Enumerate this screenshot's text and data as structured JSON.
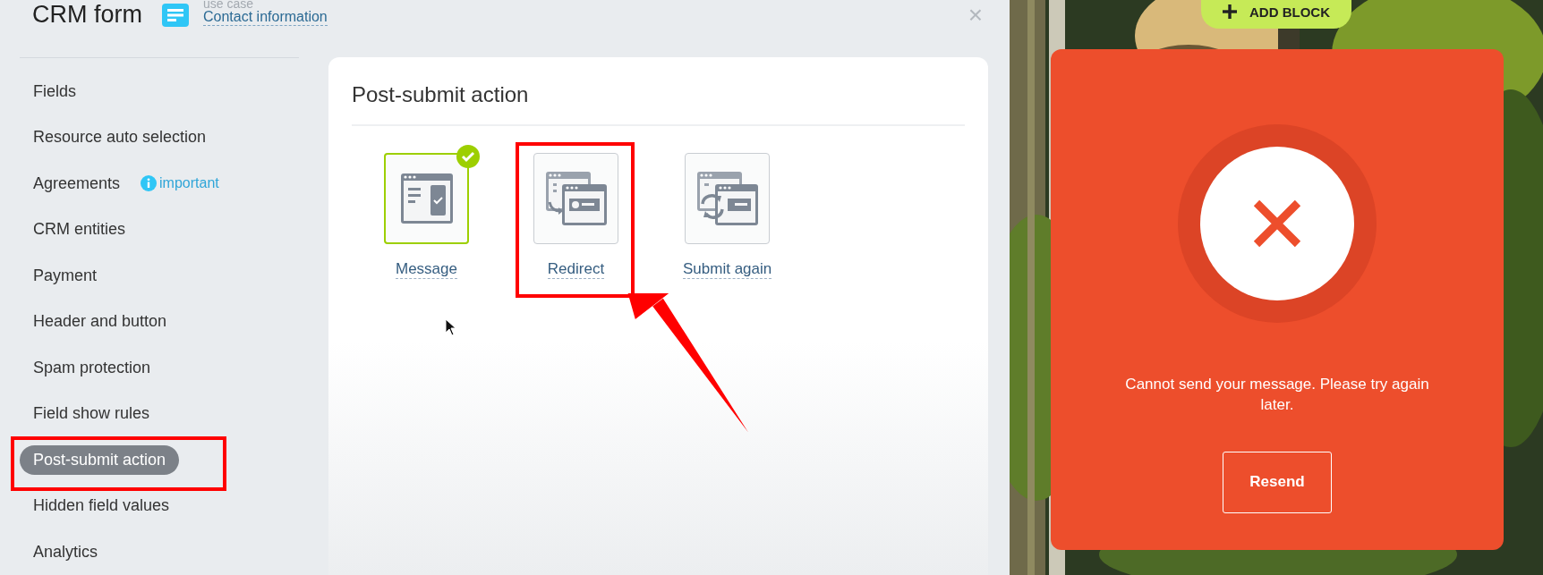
{
  "header": {
    "title": "CRM form",
    "use_case_label": "use case",
    "use_case_link": "Contact information",
    "close": "×"
  },
  "sidebar": {
    "items": [
      {
        "label": "Fields",
        "selected": false
      },
      {
        "label": "Resource auto selection",
        "selected": false
      },
      {
        "label": "Agreements",
        "selected": false,
        "badge": "important"
      },
      {
        "label": "CRM entities",
        "selected": false
      },
      {
        "label": "Payment",
        "selected": false
      },
      {
        "label": "Header and button",
        "selected": false
      },
      {
        "label": "Spam protection",
        "selected": false
      },
      {
        "label": "Field show rules",
        "selected": false
      },
      {
        "label": "Post-submit action",
        "selected": true
      },
      {
        "label": "Hidden field values",
        "selected": false
      },
      {
        "label": "Analytics",
        "selected": false
      }
    ]
  },
  "panel": {
    "title": "Post-submit action",
    "options": [
      {
        "kind": "message",
        "label": "Message",
        "selected": true
      },
      {
        "kind": "redirect",
        "label": "Redirect",
        "selected": false
      },
      {
        "kind": "resubmit",
        "label": "Submit again",
        "selected": false
      }
    ]
  },
  "preview": {
    "add_block": "ADD BLOCK",
    "error_message": "Cannot send your message. Please try again later.",
    "resend_button": "Resend"
  }
}
